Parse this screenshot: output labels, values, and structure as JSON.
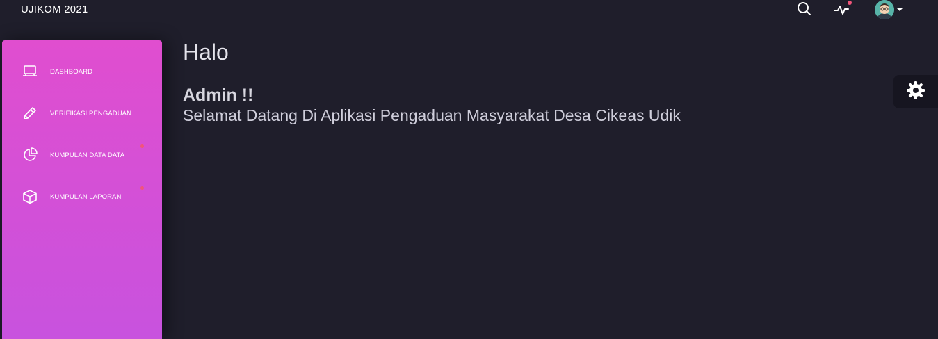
{
  "app": {
    "brand": "UJIKOM 2021"
  },
  "topbar": {
    "icons": [
      "search-icon",
      "activity-icon",
      "avatar"
    ]
  },
  "sidebar": {
    "items": [
      {
        "label": "DASHBOARD",
        "icon": "laptop-icon",
        "has_dot": false
      },
      {
        "label": "VERIFIKASI PENGADUAN",
        "icon": "pencil-icon",
        "has_dot": false
      },
      {
        "label": "KUMPULAN DATA DATA",
        "icon": "pie-chart-icon",
        "has_dot": true
      },
      {
        "label": "KUMPULAN LAPORAN",
        "icon": "box-icon",
        "has_dot": true
      }
    ]
  },
  "main": {
    "greeting": "Halo",
    "user": "Admin !!",
    "welcome": "Selamat Datang Di Aplikasi Pengaduan Masyarakat Desa Cikeas Udik"
  },
  "colors": {
    "background": "#1f1e2b",
    "sidebar_gradient_top": "#e04ecf",
    "sidebar_gradient_bottom": "#c852de",
    "notification_dot": "#f2557a"
  }
}
